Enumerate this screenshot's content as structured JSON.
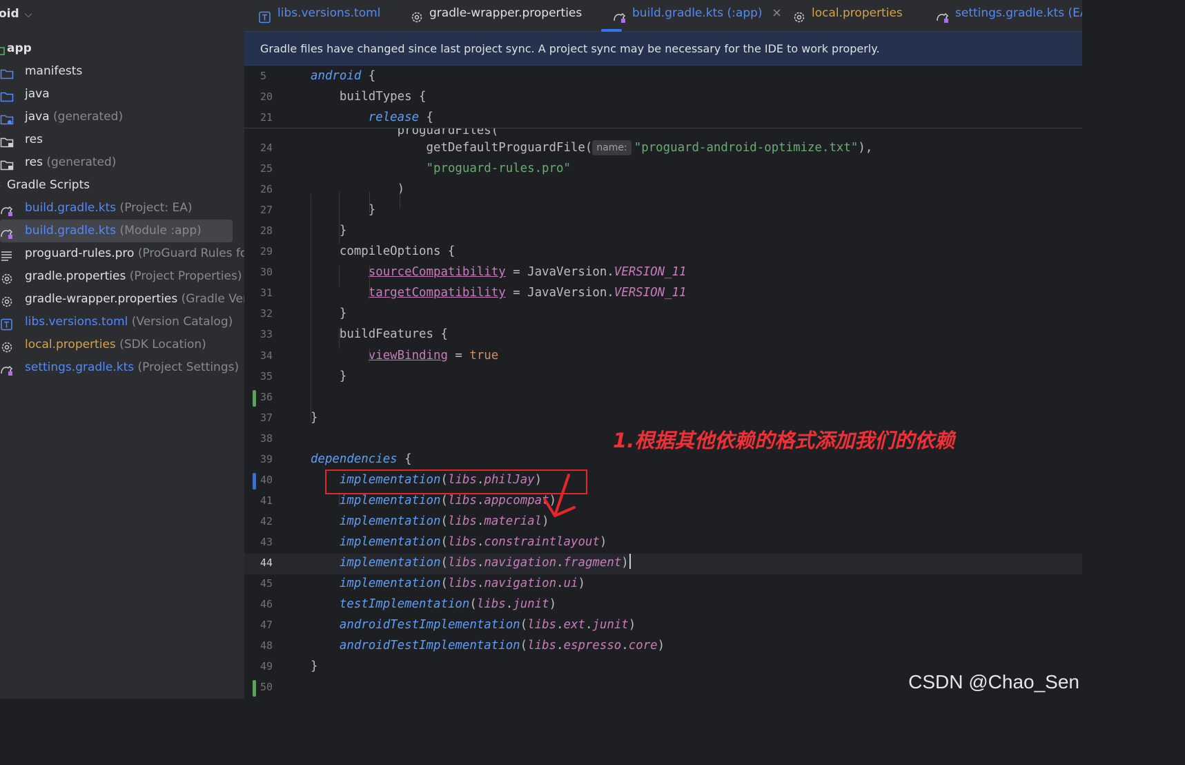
{
  "sidebar": {
    "header": "oid",
    "items": [
      {
        "label": "app",
        "hint": "",
        "icon": "module-icon"
      },
      {
        "label": "manifests",
        "hint": "",
        "icon": "folder-icon"
      },
      {
        "label": "java",
        "hint": "",
        "icon": "folder-icon"
      },
      {
        "label": "java",
        "hint": " (generated)",
        "icon": "generated-folder-icon"
      },
      {
        "label": "res",
        "hint": "",
        "icon": "resource-folder-icon"
      },
      {
        "label": "res",
        "hint": " (generated)",
        "icon": "resource-folder-icon"
      },
      {
        "label": "Gradle Scripts",
        "hint": "",
        "icon": "gradle-scripts-icon"
      },
      {
        "label": "build.gradle.kts",
        "hint": " (Project: EA)",
        "icon": "gradle-kts-icon"
      },
      {
        "label": "build.gradle.kts",
        "hint": " (Module :app)",
        "icon": "gradle-kts-icon"
      },
      {
        "label": "proguard-rules.pro",
        "hint": " (ProGuard Rules for '",
        "icon": "text-file-icon"
      },
      {
        "label": "gradle.properties",
        "hint": " (Project Properties)",
        "icon": "gear-icon"
      },
      {
        "label": "gradle-wrapper.properties",
        "hint": " (Gradle Versio",
        "icon": "gear-icon"
      },
      {
        "label": "libs.versions.toml",
        "hint": " (Version Catalog)",
        "icon": "toml-icon"
      },
      {
        "label": "local.properties",
        "hint": " (SDK Location)",
        "icon": "gear-icon"
      },
      {
        "label": "settings.gradle.kts",
        "hint": " (Project Settings)",
        "icon": "gradle-kts-icon"
      }
    ]
  },
  "tabs": [
    {
      "label": "libs.versions.toml",
      "icon": "toml-icon"
    },
    {
      "label": "gradle-wrapper.properties",
      "icon": "gear-icon"
    },
    {
      "label": "build.gradle.kts (:app)",
      "icon": "gradle-kts-icon",
      "active": true
    },
    {
      "label": "local.properties",
      "icon": "gear-icon"
    },
    {
      "label": "settings.gradle.kts (EA)",
      "icon": "gradle-kts-icon"
    }
  ],
  "tab_close": "×",
  "banner": "Gradle files have changed since last project sync. A project sync may be necessary for the IDE to work properly.",
  "sticky_lines": [
    {
      "num": "5",
      "segs": [
        {
          "t": "android",
          "c": "kw"
        },
        {
          "t": " {",
          "c": ""
        }
      ]
    },
    {
      "num": "20",
      "segs": [
        {
          "t": "    buildTypes {",
          "c": ""
        }
      ]
    },
    {
      "num": "21",
      "segs": [
        {
          "t": "        ",
          "c": ""
        },
        {
          "t": "release",
          "c": "kw"
        },
        {
          "t": " {",
          "c": ""
        }
      ]
    }
  ],
  "code_lines": [
    {
      "num": "24",
      "segs": [
        {
          "t": "                getDefaultProguardFile(",
          "c": ""
        },
        {
          "t": "name:",
          "c": "hint"
        },
        {
          "t": "\"proguard-android-optimize.txt\"",
          "c": "str"
        },
        {
          "t": "),",
          "c": ""
        }
      ]
    },
    {
      "num": "25",
      "segs": [
        {
          "t": "                ",
          "c": ""
        },
        {
          "t": "\"proguard-rules.pro\"",
          "c": "str"
        }
      ]
    },
    {
      "num": "26",
      "segs": [
        {
          "t": "            )",
          "c": ""
        }
      ]
    },
    {
      "num": "27",
      "segs": [
        {
          "t": "        }",
          "c": ""
        }
      ]
    },
    {
      "num": "28",
      "segs": [
        {
          "t": "    }",
          "c": ""
        }
      ]
    },
    {
      "num": "29",
      "segs": [
        {
          "t": "    compileOptions {",
          "c": ""
        }
      ]
    },
    {
      "num": "30",
      "segs": [
        {
          "t": "        ",
          "c": ""
        },
        {
          "t": "sourceCompatibility",
          "c": "prop"
        },
        {
          "t": " = JavaVersion.",
          "c": ""
        },
        {
          "t": "VERSION_11",
          "c": "it"
        }
      ]
    },
    {
      "num": "31",
      "segs": [
        {
          "t": "        ",
          "c": ""
        },
        {
          "t": "targetCompatibility",
          "c": "prop"
        },
        {
          "t": " = JavaVersion.",
          "c": ""
        },
        {
          "t": "VERSION_11",
          "c": "it"
        }
      ]
    },
    {
      "num": "32",
      "segs": [
        {
          "t": "    }",
          "c": ""
        }
      ]
    },
    {
      "num": "33",
      "segs": [
        {
          "t": "    buildFeatures {",
          "c": ""
        }
      ]
    },
    {
      "num": "34",
      "segs": [
        {
          "t": "        ",
          "c": ""
        },
        {
          "t": "viewBinding",
          "c": "prop"
        },
        {
          "t": " = ",
          "c": ""
        },
        {
          "t": "true",
          "c": "kwo"
        }
      ]
    },
    {
      "num": "35",
      "segs": [
        {
          "t": "    }",
          "c": ""
        }
      ]
    },
    {
      "num": "36",
      "segs": []
    },
    {
      "num": "37",
      "segs": [
        {
          "t": "}",
          "c": ""
        }
      ]
    },
    {
      "num": "38",
      "segs": []
    },
    {
      "num": "39",
      "segs": [
        {
          "t": "dependencies",
          "c": "kw"
        },
        {
          "t": " {",
          "c": ""
        }
      ]
    },
    {
      "num": "40",
      "segs": [
        {
          "t": "    ",
          "c": ""
        },
        {
          "t": "implementation",
          "c": "fn"
        },
        {
          "t": "(",
          "c": ""
        },
        {
          "t": "libs",
          "c": "it"
        },
        {
          "t": ".",
          "c": ""
        },
        {
          "t": "philJay",
          "c": "it"
        },
        {
          "t": ")",
          "c": ""
        }
      ]
    },
    {
      "num": "41",
      "segs": [
        {
          "t": "    ",
          "c": ""
        },
        {
          "t": "implementation",
          "c": "fn"
        },
        {
          "t": "(",
          "c": ""
        },
        {
          "t": "libs",
          "c": "it"
        },
        {
          "t": ".",
          "c": ""
        },
        {
          "t": "appcompat",
          "c": "it"
        },
        {
          "t": ")",
          "c": ""
        }
      ]
    },
    {
      "num": "42",
      "segs": [
        {
          "t": "    ",
          "c": ""
        },
        {
          "t": "implementation",
          "c": "fn"
        },
        {
          "t": "(",
          "c": ""
        },
        {
          "t": "libs",
          "c": "it"
        },
        {
          "t": ".",
          "c": ""
        },
        {
          "t": "material",
          "c": "it"
        },
        {
          "t": ")",
          "c": ""
        }
      ]
    },
    {
      "num": "43",
      "segs": [
        {
          "t": "    ",
          "c": ""
        },
        {
          "t": "implementation",
          "c": "fn"
        },
        {
          "t": "(",
          "c": ""
        },
        {
          "t": "libs",
          "c": "it"
        },
        {
          "t": ".",
          "c": ""
        },
        {
          "t": "constraintlayout",
          "c": "it"
        },
        {
          "t": ")",
          "c": ""
        }
      ]
    },
    {
      "num": "44",
      "segs": [
        {
          "t": "    ",
          "c": ""
        },
        {
          "t": "implementation",
          "c": "fn"
        },
        {
          "t": "(",
          "c": ""
        },
        {
          "t": "libs",
          "c": "it"
        },
        {
          "t": ".",
          "c": ""
        },
        {
          "t": "navigation",
          "c": "it"
        },
        {
          "t": ".",
          "c": ""
        },
        {
          "t": "fragment",
          "c": "it"
        },
        {
          "t": ")",
          "c": ""
        }
      ],
      "current": true
    },
    {
      "num": "45",
      "segs": [
        {
          "t": "    ",
          "c": ""
        },
        {
          "t": "implementation",
          "c": "fn"
        },
        {
          "t": "(",
          "c": ""
        },
        {
          "t": "libs",
          "c": "it"
        },
        {
          "t": ".",
          "c": ""
        },
        {
          "t": "navigation",
          "c": "it"
        },
        {
          "t": ".",
          "c": ""
        },
        {
          "t": "ui",
          "c": "it"
        },
        {
          "t": ")",
          "c": ""
        }
      ]
    },
    {
      "num": "46",
      "segs": [
        {
          "t": "    ",
          "c": ""
        },
        {
          "t": "testImplementation",
          "c": "fn"
        },
        {
          "t": "(",
          "c": ""
        },
        {
          "t": "libs",
          "c": "it"
        },
        {
          "t": ".",
          "c": ""
        },
        {
          "t": "junit",
          "c": "it"
        },
        {
          "t": ")",
          "c": ""
        }
      ]
    },
    {
      "num": "47",
      "segs": [
        {
          "t": "    ",
          "c": ""
        },
        {
          "t": "androidTestImplementation",
          "c": "fn"
        },
        {
          "t": "(",
          "c": ""
        },
        {
          "t": "libs",
          "c": "it"
        },
        {
          "t": ".",
          "c": ""
        },
        {
          "t": "ext",
          "c": "it"
        },
        {
          "t": ".",
          "c": ""
        },
        {
          "t": "junit",
          "c": "it"
        },
        {
          "t": ")",
          "c": ""
        }
      ]
    },
    {
      "num": "48",
      "segs": [
        {
          "t": "    ",
          "c": ""
        },
        {
          "t": "androidTestImplementation",
          "c": "fn"
        },
        {
          "t": "(",
          "c": ""
        },
        {
          "t": "libs",
          "c": "it"
        },
        {
          "t": ".",
          "c": ""
        },
        {
          "t": "espresso",
          "c": "it"
        },
        {
          "t": ".",
          "c": ""
        },
        {
          "t": "core",
          "c": "it"
        },
        {
          "t": ")",
          "c": ""
        }
      ]
    },
    {
      "num": "49",
      "segs": [
        {
          "t": "}",
          "c": ""
        }
      ]
    },
    {
      "num": "50",
      "segs": []
    }
  ],
  "partial_line_text": "            proguardFiles(",
  "annotation": "1.根据其他依赖的格式添加我们的依赖",
  "watermark": "CSDN @Chao_Sen",
  "colors": {
    "accent": "#3574f0",
    "annotation_red": "#e8262a",
    "added_line": "#5fa05f",
    "modified_line": "#3f6fc7"
  }
}
